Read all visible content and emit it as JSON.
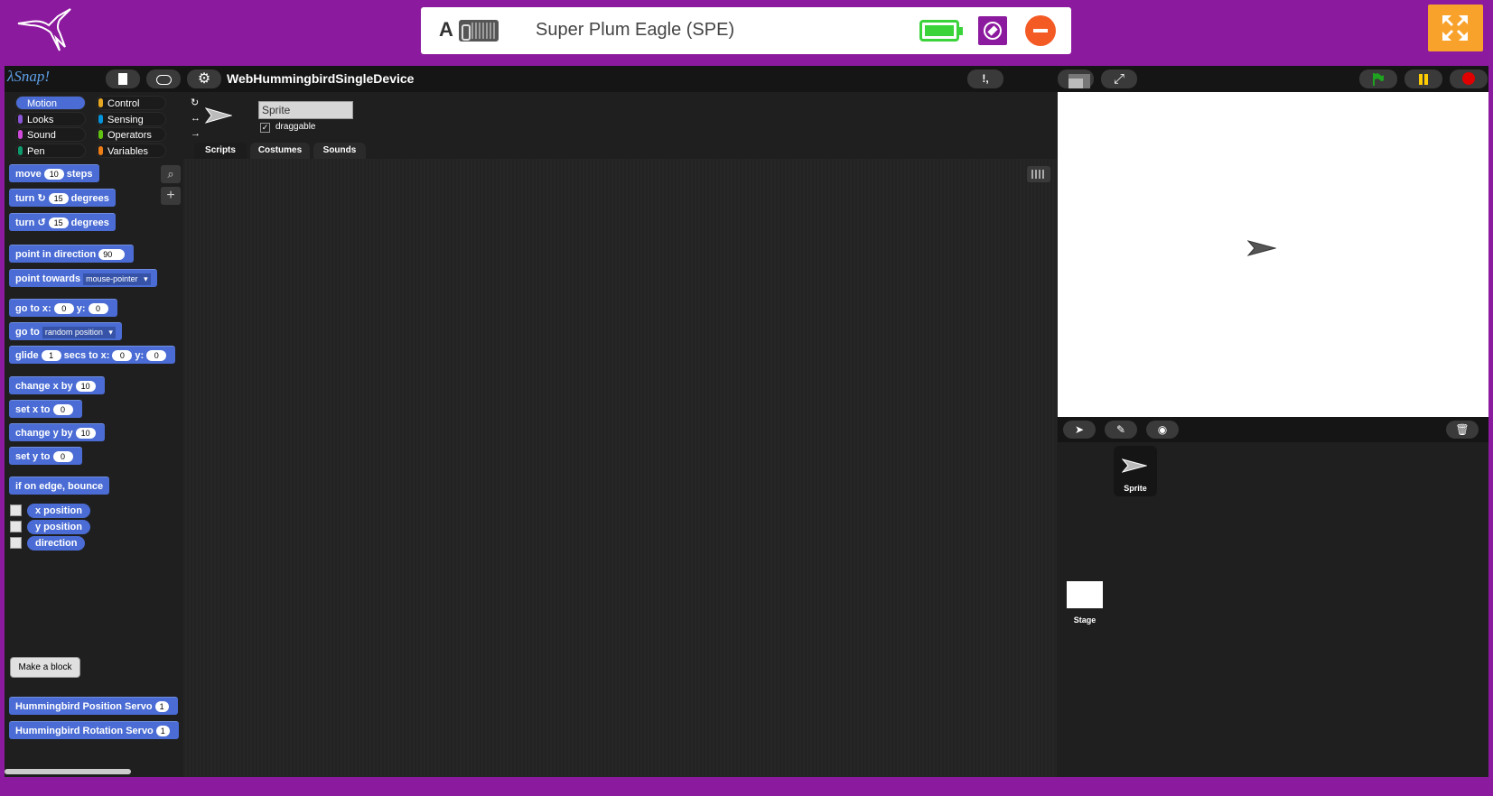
{
  "device": {
    "letter": "A",
    "name": "Super Plum Eagle (SPE)"
  },
  "toolbar": {
    "logo": "λSnap!",
    "project_title": "WebHummingbirdSingleDevice",
    "unused_blocks": "!,"
  },
  "categories": [
    "Motion",
    "Control",
    "Looks",
    "Sensing",
    "Sound",
    "Operators",
    "Pen",
    "Variables"
  ],
  "category_colors": [
    "#4a6cd4",
    "#e6a822",
    "#8a55d7",
    "#0494dc",
    "#cf4ad9",
    "#62c213",
    "#0e9a6c",
    "#ee7d16"
  ],
  "blocks": {
    "move": [
      "move",
      "10",
      "steps"
    ],
    "turn_cw": [
      "turn",
      "↻",
      "15",
      "degrees"
    ],
    "turn_ccw": [
      "turn",
      "↺",
      "15",
      "degrees"
    ],
    "point_dir": [
      "point in direction",
      "90"
    ],
    "point_towards": [
      "point towards",
      "mouse-pointer"
    ],
    "goto_xy": [
      "go to x:",
      "0",
      "y:",
      "0"
    ],
    "goto": [
      "go to",
      "random position"
    ],
    "glide": [
      "glide",
      "1",
      "secs to x:",
      "0",
      "y:",
      "0"
    ],
    "change_x": [
      "change x by",
      "10"
    ],
    "set_x": [
      "set x to",
      "0"
    ],
    "change_y": [
      "change y by",
      "10"
    ],
    "set_y": [
      "set y to",
      "0"
    ],
    "bounce": "if on edge, bounce",
    "x_position": "x position",
    "y_position": "y position",
    "direction": "direction",
    "make_block": "Make a block",
    "position_servo": [
      "Hummingbird Position Servo",
      "1"
    ],
    "rotation_servo": [
      "Hummingbird Rotation Servo",
      "1"
    ]
  },
  "sprite": {
    "name": "Sprite",
    "draggable_label": "draggable",
    "draggable_checked": "✓"
  },
  "tabs": [
    "Scripts",
    "Costumes",
    "Sounds"
  ],
  "corral": {
    "sprite_label": "Sprite",
    "stage_label": "Stage"
  }
}
